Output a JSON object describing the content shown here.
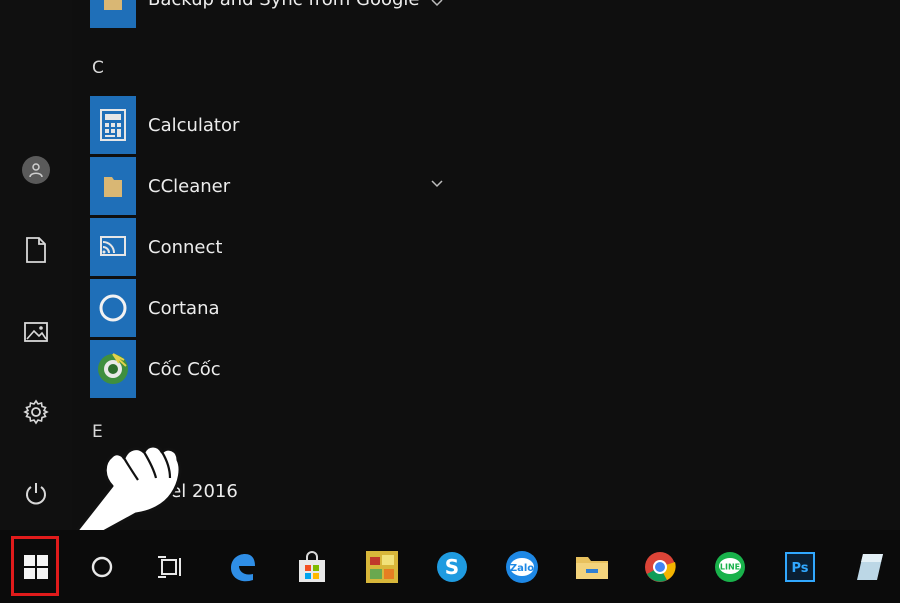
{
  "app_list": {
    "partial_top_item": "Backup and Sync from Google",
    "sections": [
      {
        "letter": "C"
      },
      {
        "letter": "E"
      }
    ],
    "apps": [
      {
        "label": "Calculator",
        "icon": "calculator-icon"
      },
      {
        "label": "CCleaner",
        "icon": "folder-icon"
      },
      {
        "label": "Connect",
        "icon": "connect-icon"
      },
      {
        "label": "Cortana",
        "icon": "cortana-icon"
      },
      {
        "label": "Cốc Cốc",
        "icon": "coccoc-icon"
      }
    ],
    "partial_bottom_item": "xcel 2016"
  },
  "left_rail": {
    "icons": [
      "user-icon",
      "document-icon",
      "pictures-icon",
      "settings-icon",
      "power-icon"
    ]
  },
  "taskbar": {
    "items": [
      "windows-start-icon",
      "cortana-search-icon",
      "task-view-icon",
      "edge-icon",
      "store-icon",
      "game-icon",
      "skype-icon",
      "zalo-icon",
      "file-explorer-icon",
      "chrome-icon",
      "line-icon",
      "photoshop-icon",
      "app-icon"
    ],
    "zalo_label": "Zalo",
    "line_label": "LINE",
    "photoshop_label": "Ps",
    "skype_label": "S"
  },
  "colors": {
    "tile_blue": "#1f6fb8",
    "start_highlight": "#e01b1b",
    "background": "#0f0f0f"
  }
}
